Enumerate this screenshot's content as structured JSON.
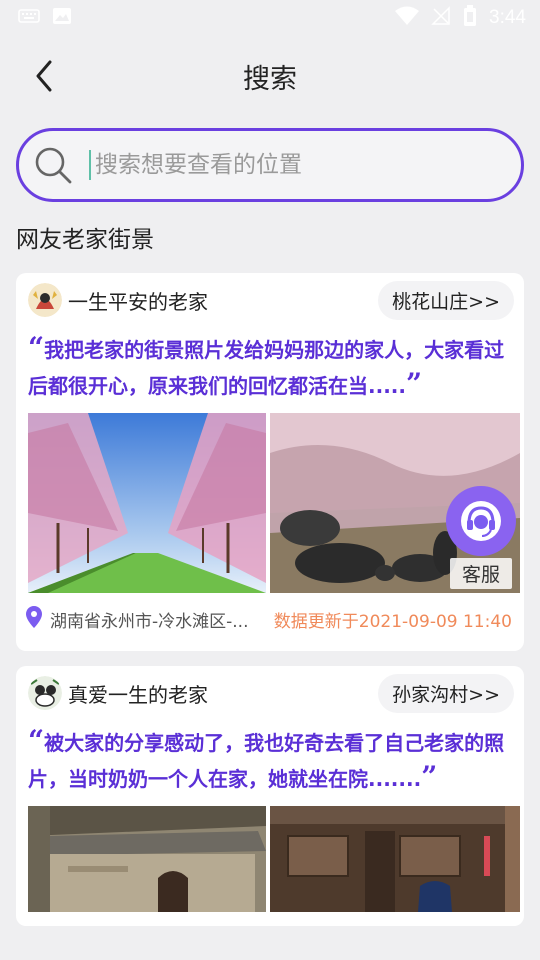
{
  "status_bar": {
    "time": "3:44",
    "icons": [
      "keyboard-icon",
      "image-icon",
      "wifi-icon",
      "signal-off-icon",
      "battery-icon"
    ]
  },
  "header": {
    "title": "搜索",
    "back_icon": "chevron-left-icon"
  },
  "search": {
    "placeholder": "搜索想要查看的位置",
    "value": ""
  },
  "section": {
    "title": "网友老家街景"
  },
  "cards": [
    {
      "username": "一生平安的老家",
      "location": "桃花山庄>>",
      "quote": "我把老家的街景照片发给妈妈那边的家人，大家看过后都很开心，原来我们的回忆都活在当.....",
      "address": "湖南省永州市-冷水滩区-...",
      "updated": "数据更新于2021-09-09 11:40"
    },
    {
      "username": "真爱一生的老家",
      "location": "孙家沟村>>",
      "quote": "被大家的分享感动了，我也好奇去看了自己老家的照片，当时奶奶一个人在家，她就坐在院......."
    }
  ],
  "customer_service": {
    "label": "客服"
  },
  "colors": {
    "accent": "#6a3fe0",
    "quote": "#5a2fd6",
    "updated": "#f08a5a",
    "pin": "#7b5cf0"
  }
}
